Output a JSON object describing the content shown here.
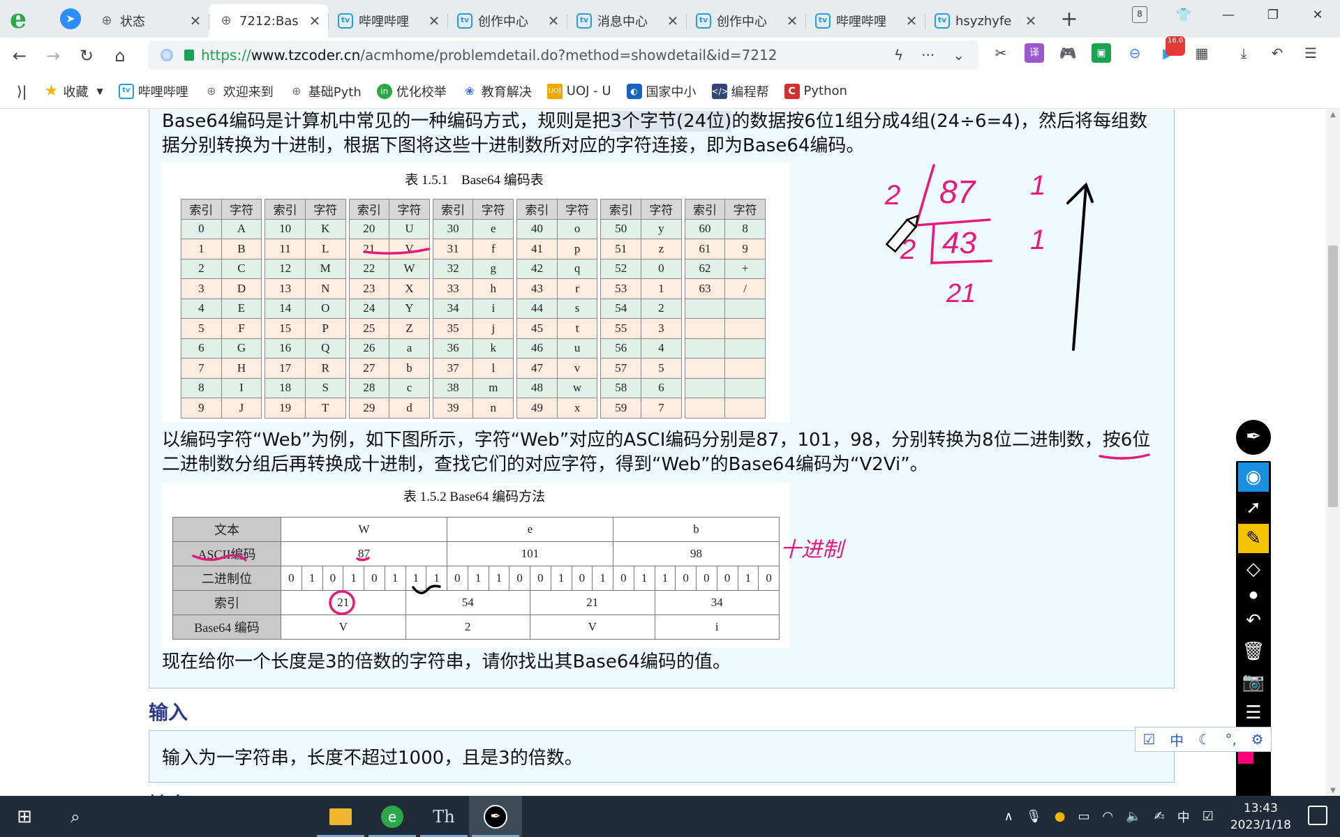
{
  "browser": {
    "tabs": [
      {
        "title": "状态",
        "icon": "globe-icon",
        "active": false
      },
      {
        "title": "7212:Bas",
        "icon": "globe-icon",
        "active": true
      },
      {
        "title": "哔哩哔哩",
        "icon": "bilibili-icon",
        "active": false
      },
      {
        "title": "创作中心",
        "icon": "bilibili-icon",
        "active": false
      },
      {
        "title": "消息中心",
        "icon": "bilibili-icon",
        "active": false
      },
      {
        "title": "创作中心",
        "icon": "bilibili-icon",
        "active": false
      },
      {
        "title": "哔哩哔哩",
        "icon": "bilibili-icon",
        "active": false
      },
      {
        "title": "hsyzhyfe",
        "icon": "bilibili-icon",
        "active": false
      }
    ],
    "tab_count": "8",
    "url_scheme": "https://",
    "url_host": "www.tzcoder.cn",
    "url_path": "/acmhome/problemdetail.do?method=showdetail&id=7212",
    "ext_badge": "16.0",
    "translate_label": "译",
    "bookmarks": [
      {
        "label": "收藏",
        "icon": "star-icon"
      },
      {
        "label": "哔哩哔哩",
        "icon": "bilibili-icon"
      },
      {
        "label": "欢迎来到",
        "icon": "globe-icon"
      },
      {
        "label": "基础Pyth",
        "icon": "globe-icon"
      },
      {
        "label": "优化校举",
        "icon": "green-circle-icon"
      },
      {
        "label": "教育解决",
        "icon": "paw-icon"
      },
      {
        "label": "UOJ - U",
        "icon": "uoj-icon"
      },
      {
        "label": "国家中小",
        "icon": "gov-icon"
      },
      {
        "label": "编程帮",
        "icon": "code-icon"
      },
      {
        "label": "Python",
        "icon": "c-icon"
      }
    ]
  },
  "problem": {
    "para1_a": "Base64编码是计算机中常见的一种编码方式，规则是把",
    "para1_hl": "3个字节(24位)",
    "para1_b": "的数据按6位1组分成4组(24÷6=4)，然后将每组数",
    "para1_line2": "据分别转换为十进制，根据下图将这些十进制数所对应的字符连接，即为Base64编码。",
    "table1_caption": "表 1.5.1　Base64 编码表",
    "table1_header_index": "索引",
    "table1_header_char": "字符",
    "table1_columns": [
      [
        [
          "0",
          "A"
        ],
        [
          "1",
          "B"
        ],
        [
          "2",
          "C"
        ],
        [
          "3",
          "D"
        ],
        [
          "4",
          "E"
        ],
        [
          "5",
          "F"
        ],
        [
          "6",
          "G"
        ],
        [
          "7",
          "H"
        ],
        [
          "8",
          "I"
        ],
        [
          "9",
          "J"
        ]
      ],
      [
        [
          "10",
          "K"
        ],
        [
          "11",
          "L"
        ],
        [
          "12",
          "M"
        ],
        [
          "13",
          "N"
        ],
        [
          "14",
          "O"
        ],
        [
          "15",
          "P"
        ],
        [
          "16",
          "Q"
        ],
        [
          "17",
          "R"
        ],
        [
          "18",
          "S"
        ],
        [
          "19",
          "T"
        ]
      ],
      [
        [
          "20",
          "U"
        ],
        [
          "21",
          "V"
        ],
        [
          "22",
          "W"
        ],
        [
          "23",
          "X"
        ],
        [
          "24",
          "Y"
        ],
        [
          "25",
          "Z"
        ],
        [
          "26",
          "a"
        ],
        [
          "27",
          "b"
        ],
        [
          "28",
          "c"
        ],
        [
          "29",
          "d"
        ]
      ],
      [
        [
          "30",
          "e"
        ],
        [
          "31",
          "f"
        ],
        [
          "32",
          "g"
        ],
        [
          "33",
          "h"
        ],
        [
          "34",
          "i"
        ],
        [
          "35",
          "j"
        ],
        [
          "36",
          "k"
        ],
        [
          "37",
          "l"
        ],
        [
          "38",
          "m"
        ],
        [
          "39",
          "n"
        ]
      ],
      [
        [
          "40",
          "o"
        ],
        [
          "41",
          "p"
        ],
        [
          "42",
          "q"
        ],
        [
          "43",
          "r"
        ],
        [
          "44",
          "s"
        ],
        [
          "45",
          "t"
        ],
        [
          "46",
          "u"
        ],
        [
          "47",
          "v"
        ],
        [
          "48",
          "w"
        ],
        [
          "49",
          "x"
        ]
      ],
      [
        [
          "50",
          "y"
        ],
        [
          "51",
          "z"
        ],
        [
          "52",
          "0"
        ],
        [
          "53",
          "1"
        ],
        [
          "54",
          "2"
        ],
        [
          "55",
          "3"
        ],
        [
          "56",
          "4"
        ],
        [
          "57",
          "5"
        ],
        [
          "58",
          "6"
        ],
        [
          "59",
          "7"
        ]
      ],
      [
        [
          "60",
          "8"
        ],
        [
          "61",
          "9"
        ],
        [
          "62",
          "+"
        ],
        [
          "63",
          "/"
        ],
        [
          "",
          ""
        ],
        [
          "",
          ""
        ],
        [
          "",
          ""
        ],
        [
          "",
          ""
        ],
        [
          "",
          ""
        ],
        [
          "",
          ""
        ]
      ]
    ],
    "para2_line1": "以编码字符“Web”为例，如下图所示，字符“Web”对应的ASCI编码分别是87，101，98，分别转换为8位二进制数，按6位",
    "para2_line2": "二进制数分组后再转换成十进制，查找它们的对应字符，得到“Web”的Base64编码为“V2Vi”。",
    "table2_caption": "表 1.5.2  Base64 编码方法",
    "table2": {
      "row_text_label": "文本",
      "text": [
        "W",
        "e",
        "b"
      ],
      "row_ascii_label": "ASCII编码",
      "ascii": [
        "87",
        "101",
        "98"
      ],
      "row_bits_label": "二进制位",
      "bits": [
        "0",
        "1",
        "0",
        "1",
        "0",
        "1",
        "1",
        "1",
        "0",
        "1",
        "1",
        "0",
        "0",
        "1",
        "0",
        "1",
        "0",
        "1",
        "1",
        "0",
        "0",
        "0",
        "1",
        "0"
      ],
      "row_index_label": "索引",
      "index": [
        "21",
        "54",
        "21",
        "34"
      ],
      "row_b64_label": "Base64 编码",
      "b64": [
        "V",
        "2",
        "V",
        "i"
      ]
    },
    "para3": "现在给你一个长度是3的倍数的字符串，请你找出其Base64编码的值。",
    "input_heading": "输入",
    "input_text": "输入为一字符串，长度不超过1000，且是3的倍数。",
    "next_heading": "输出"
  },
  "annotations": {
    "ink_color": "#e6197d",
    "handwritten_note": "十进制",
    "calc_divisor_1": "2",
    "calc_dividend_1": "87",
    "calc_remainder_1": "1",
    "calc_divisor_2": "2",
    "calc_dividend_2": "43",
    "calc_remainder_2": "1",
    "calc_quotient": "21"
  },
  "ime": {
    "lang": "中"
  },
  "taskbar": {
    "tray_lang": "中",
    "time": "13:43",
    "date": "2023/1/18"
  }
}
